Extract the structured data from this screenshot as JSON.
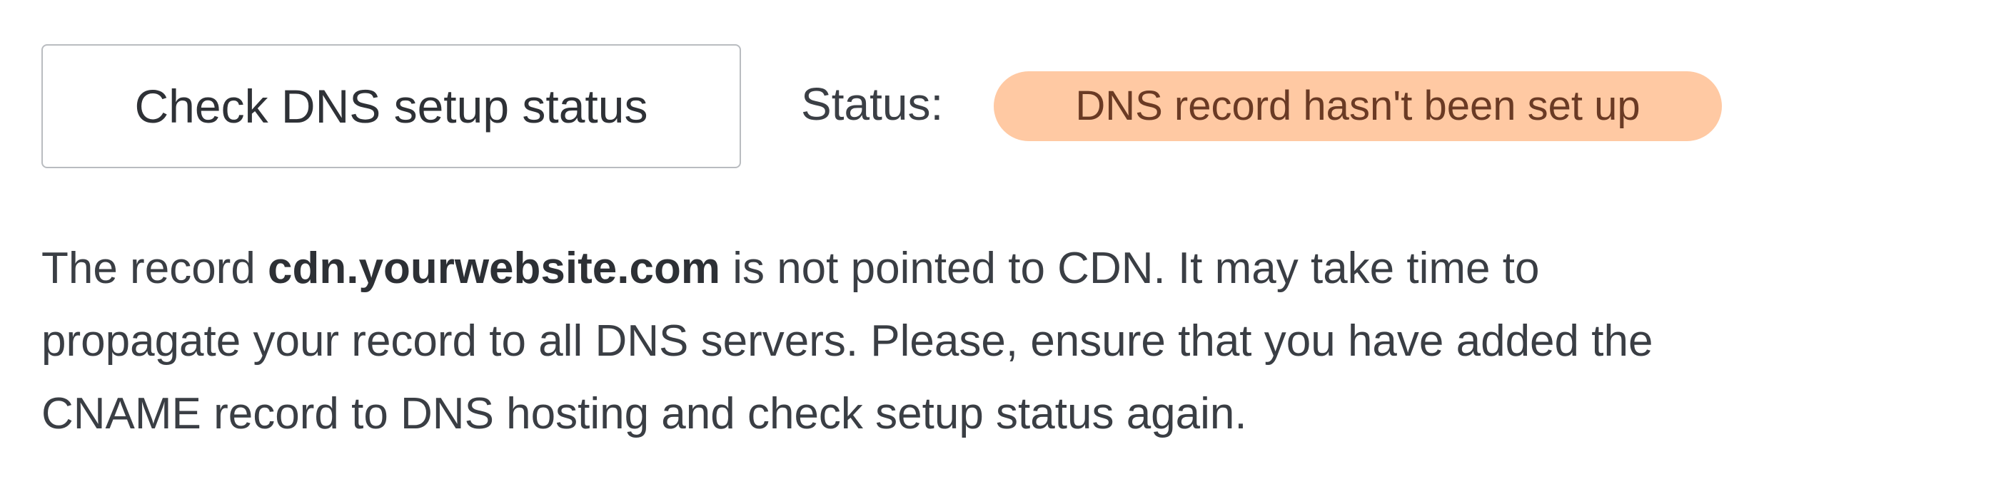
{
  "dns_setup": {
    "check_button_label": "Check DNS setup status",
    "status_label": "Status:",
    "status_badge_text": "DNS record hasn't been set up",
    "status_badge_color": "#ffc9a3",
    "status_badge_text_color": "#6a3a24"
  },
  "message": {
    "line1_prefix": "The record ",
    "domain": "cdn.yourwebsite.com",
    "line1_suffix": " is not pointed to CDN. It may take time to",
    "line2": "propagate your record to all DNS servers. Please, ensure that you have added the",
    "line3": "CNAME record to DNS hosting and check setup status again."
  }
}
